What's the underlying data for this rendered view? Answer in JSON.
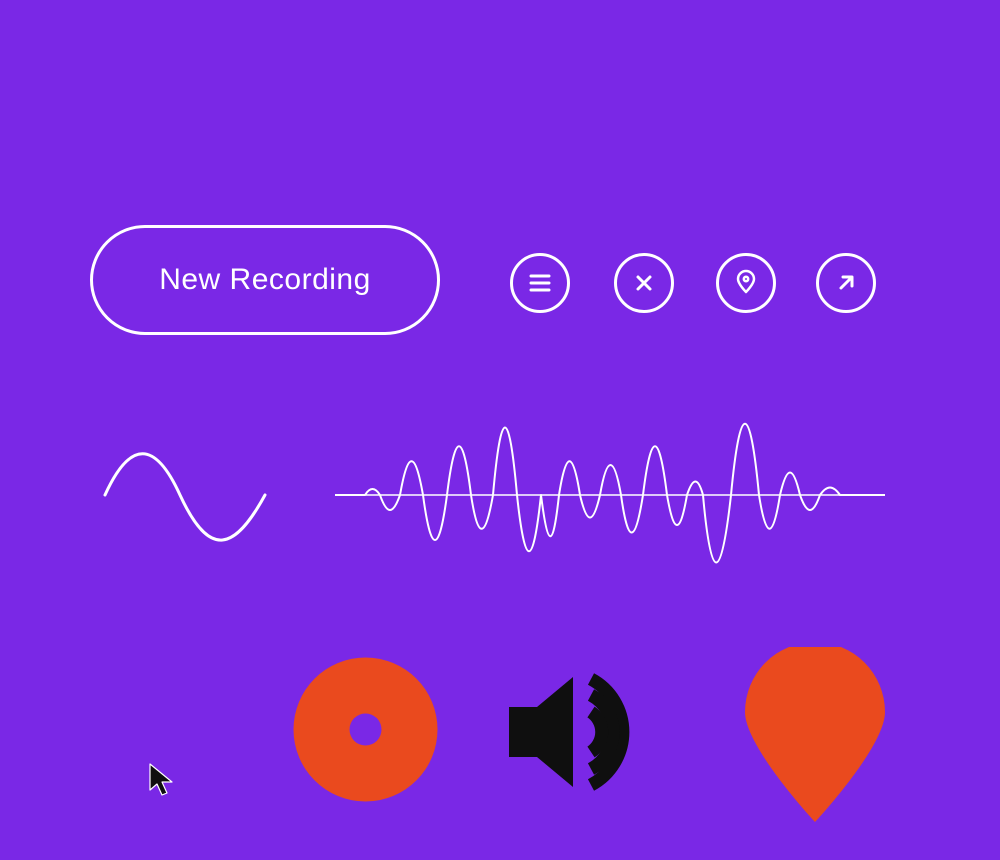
{
  "colors": {
    "background": "#7A28E6",
    "stroke": "#FFFFFF",
    "accent_orange": "#EA4A1E",
    "accent_black": "#0F0F0F"
  },
  "pill_button": {
    "label": "New Recording"
  },
  "circle_buttons": [
    {
      "name": "menu"
    },
    {
      "name": "close"
    },
    {
      "name": "pin"
    },
    {
      "name": "arrow-up-right"
    }
  ],
  "waveforms": {
    "small": "single-period sine glyph",
    "large": "audio-recording waveform glyph"
  },
  "bottom_icons": [
    {
      "name": "record-dot",
      "color": "accent_orange"
    },
    {
      "name": "speaker-loud",
      "color": "accent_black"
    },
    {
      "name": "map-pin-fill",
      "color": "accent_orange"
    }
  ],
  "cursor": {
    "name": "default-pointer",
    "color": "accent_black"
  }
}
